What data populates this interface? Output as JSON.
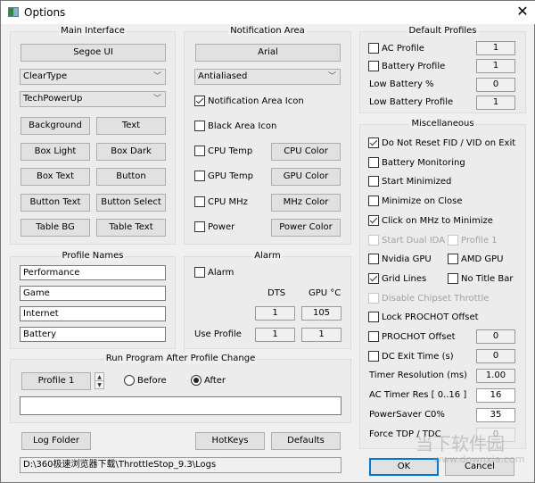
{
  "window": {
    "title": "Options",
    "close_icon": "✕"
  },
  "main_interface": {
    "title": "Main Interface",
    "font_button": "Segoe UI",
    "rendering": "ClearType",
    "theme": "TechPowerUp",
    "color_buttons": [
      "Background",
      "Text",
      "Box Light",
      "Box Dark",
      "Box Text",
      "Button",
      "Button Text",
      "Button Select",
      "Table BG",
      "Table Text"
    ]
  },
  "notification_area": {
    "title": "Notification Area",
    "font_button": "Arial",
    "rendering": "Antialiased",
    "notification_icon": {
      "label": "Notification Area Icon",
      "checked": true
    },
    "black_icon": {
      "label": "Black Area Icon",
      "checked": false
    },
    "rows": [
      {
        "label": "CPU Temp",
        "checked": false,
        "button": "CPU Color"
      },
      {
        "label": "GPU Temp",
        "checked": false,
        "button": "GPU Color"
      },
      {
        "label": "CPU MHz",
        "checked": false,
        "button": "MHz Color"
      },
      {
        "label": "Power",
        "checked": false,
        "button": "Power Color"
      }
    ]
  },
  "default_profiles": {
    "title": "Default Profiles",
    "ac_profile": {
      "label": "AC Profile",
      "checked": false,
      "value": "1"
    },
    "battery_profile": {
      "label": "Battery Profile",
      "checked": false,
      "value": "1"
    },
    "low_battery_pct": {
      "label": "Low Battery %",
      "value": "0"
    },
    "low_battery_profile": {
      "label": "Low Battery Profile",
      "value": "1"
    }
  },
  "misc": {
    "title": "Miscellaneous",
    "do_not_reset": {
      "label": "Do Not Reset FID / VID on Exit",
      "checked": true
    },
    "battery_monitoring": {
      "label": "Battery Monitoring",
      "checked": false
    },
    "start_minimized": {
      "label": "Start Minimized",
      "checked": false
    },
    "minimize_on_close": {
      "label": "Minimize on Close",
      "checked": false
    },
    "click_mhz": {
      "label": "Click on MHz to Minimize",
      "checked": true
    },
    "start_dual_ida": {
      "label": "Start Dual IDA",
      "checked": false,
      "disabled": true
    },
    "profile1": {
      "label": "Profile 1",
      "checked": false,
      "disabled": true
    },
    "nvidia_gpu": {
      "label": "Nvidia GPU",
      "checked": false
    },
    "amd_gpu": {
      "label": "AMD GPU",
      "checked": false
    },
    "grid_lines": {
      "label": "Grid Lines",
      "checked": true
    },
    "no_title_bar": {
      "label": "No Title Bar",
      "checked": false
    },
    "disable_chipset": {
      "label": "Disable Chipset Throttle",
      "checked": false,
      "disabled": true
    },
    "lock_prochot": {
      "label": "Lock PROCHOT Offset",
      "checked": false
    },
    "prochot_offset": {
      "label": "PROCHOT Offset",
      "checked": false,
      "value": "0"
    },
    "dc_exit_time": {
      "label": "DC Exit Time (s)",
      "checked": false,
      "value": "0"
    },
    "timer_resolution": {
      "label": "Timer Resolution (ms)",
      "value": "1.00"
    },
    "ac_timer_res": {
      "label": "AC Timer Res [ 0..16 ]",
      "value": "16"
    },
    "powersaver": {
      "label": "PowerSaver C0%",
      "value": "35"
    },
    "force_tdp": {
      "label": "Force TDP / TDC",
      "value": "0"
    }
  },
  "profile_names": {
    "title": "Profile Names",
    "names": [
      "Performance",
      "Game",
      "Internet",
      "Battery"
    ]
  },
  "alarm": {
    "title": "Alarm",
    "alarm_checkbox": {
      "label": "Alarm",
      "checked": false
    },
    "col_dts": "DTS",
    "col_gpu": "GPU °C",
    "dts_value": "1",
    "gpu_value": "105",
    "use_profile_label": "Use Profile",
    "use_profile_dts": "1",
    "use_profile_gpu": "1"
  },
  "run_program": {
    "title": "Run Program After Profile Change",
    "profile_button": "Profile 1",
    "before_label": "Before",
    "after_label": "After",
    "selected": "After",
    "command": ""
  },
  "bottom": {
    "log_folder": "Log Folder",
    "hotkeys": "HotKeys",
    "defaults": "Defaults",
    "log_path": "D:\\360极速浏览器下载\\ThrottleStop_9.3\\Logs",
    "ok": "OK",
    "cancel": "Cancel"
  },
  "watermark": {
    "text": "当下软件园",
    "url": "www.downxia.com"
  }
}
